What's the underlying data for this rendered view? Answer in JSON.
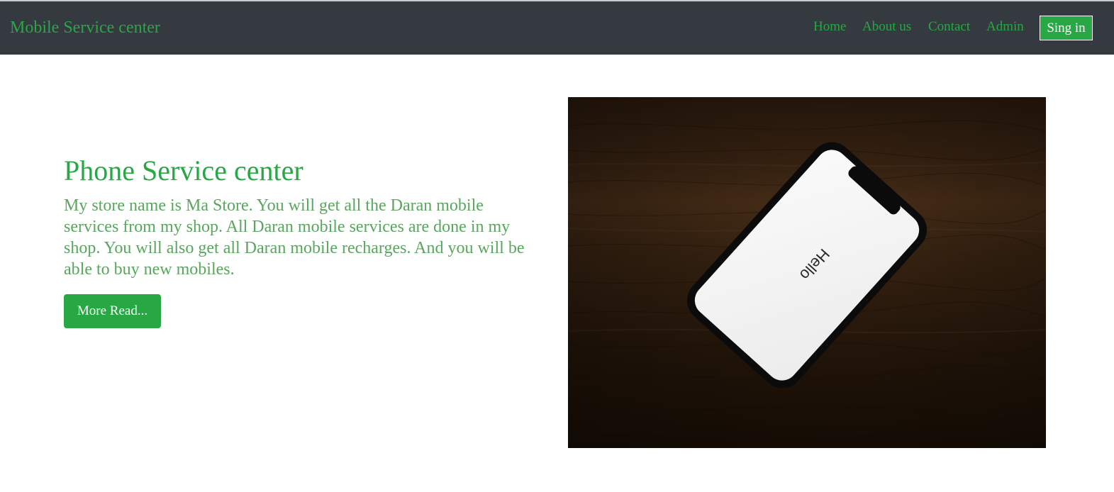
{
  "navbar": {
    "brand": "Mobile Service center",
    "links": [
      {
        "label": "Home"
      },
      {
        "label": "About us"
      },
      {
        "label": "Contact"
      },
      {
        "label": "Admin"
      }
    ],
    "signin_label": "Sing in"
  },
  "hero": {
    "title": "Phone Service center",
    "description": "My store name is Ma Store. You will get all the Daran mobile services from my shop. All Daran mobile services are done in my shop. You will also get all Daran mobile recharges. And you will be able to buy new mobiles.",
    "button_label": "More Read...",
    "image": {
      "subject": "smartphone-on-wooden-table",
      "screen_text": "Hello"
    }
  },
  "colors": {
    "navbar_bg": "#343a40",
    "accent": "#28a745",
    "body_text": "#5aa55f"
  }
}
